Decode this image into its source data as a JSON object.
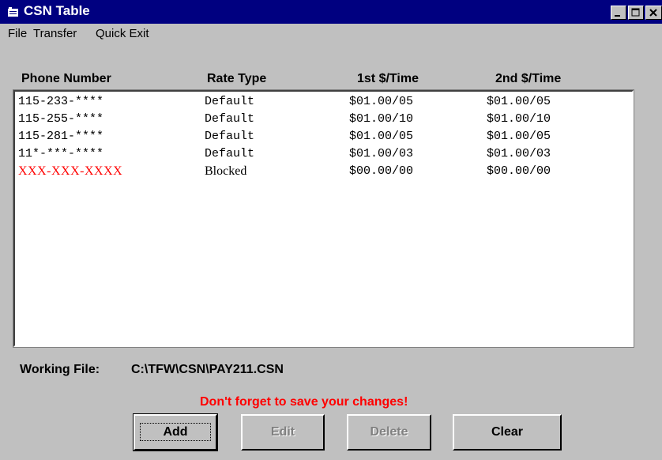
{
  "window": {
    "title": "CSN Table"
  },
  "menu": [
    "File",
    "Transfer",
    "Quick Exit"
  ],
  "columns": [
    "Phone Number",
    "Rate Type",
    "1st $/Time",
    "2nd $/Time"
  ],
  "rows": [
    {
      "phone": "115-233-****",
      "rate": "Default",
      "first": "$01.00/05",
      "second": "$01.00/05"
    },
    {
      "phone": "115-255-****",
      "rate": "Default",
      "first": "$01.00/10",
      "second": "$01.00/10"
    },
    {
      "phone": "115-281-****",
      "rate": "Default",
      "first": "$01.00/05",
      "second": "$01.00/05"
    },
    {
      "phone": "11*-***-****",
      "rate": "Default",
      "first": "$01.00/03",
      "second": "$01.00/03"
    },
    {
      "phone": "XXX-XXX-XXXX",
      "rate": "Blocked",
      "first": "$00.00/00",
      "second": "$00.00/00"
    }
  ],
  "working_file": {
    "label": "Working File:",
    "path": "C:\\TFW\\CSN\\PAY211.CSN"
  },
  "warning": "Don't forget to save your changes!",
  "buttons": {
    "add": "Add",
    "edit": "Edit",
    "delete": "Delete",
    "clear": "Clear"
  },
  "colors": {
    "titlebar": "#000080",
    "face": "#c0c0c0",
    "blocked": "#ff0000",
    "warning": "#ff0000"
  }
}
